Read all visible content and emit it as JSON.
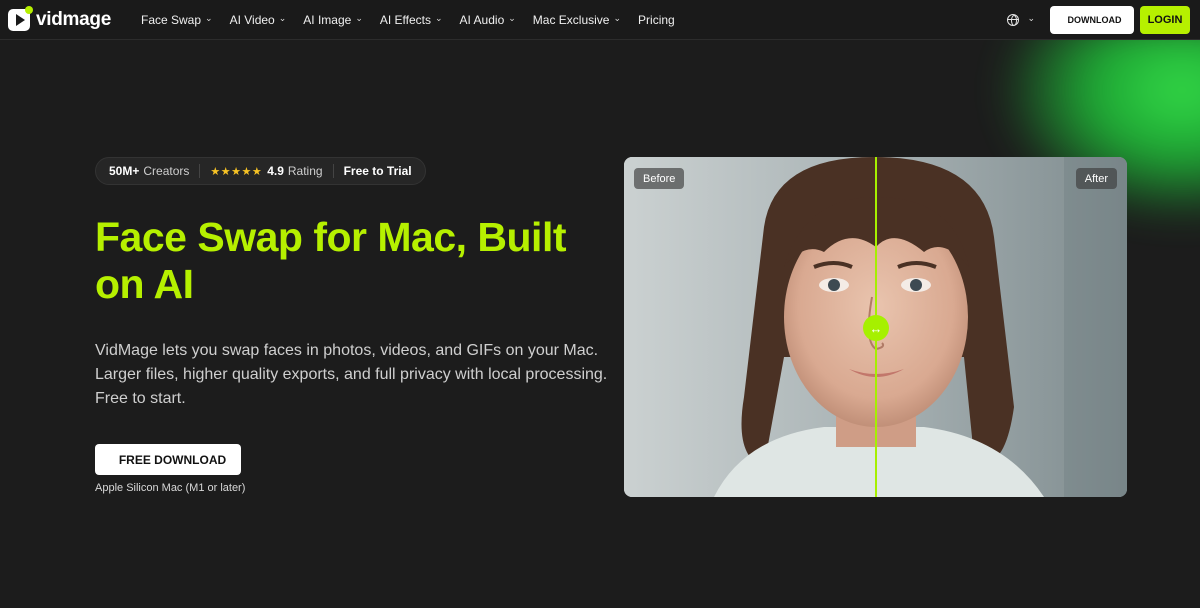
{
  "brand": {
    "name": "vidmage"
  },
  "nav": {
    "items": [
      {
        "label": "Face Swap",
        "dropdown": true
      },
      {
        "label": "AI Video",
        "dropdown": true
      },
      {
        "label": "AI Image",
        "dropdown": true
      },
      {
        "label": "AI Effects",
        "dropdown": true
      },
      {
        "label": "AI Audio",
        "dropdown": true
      },
      {
        "label": "Mac Exclusive",
        "dropdown": true
      },
      {
        "label": "Pricing",
        "dropdown": false
      }
    ],
    "language_icon": "globe-icon",
    "download_label": "DOWNLOAD",
    "login_label": "LOGIN"
  },
  "hero": {
    "stat_creators_value": "50M+",
    "stat_creators_label": "Creators",
    "stars": "★★★★★",
    "rating_value": "4.9",
    "rating_label": "Rating",
    "trial_label": "Free to Trial",
    "headline": "Face Swap for Mac, Built on AI",
    "description": "VidMage lets you swap faces in photos, videos, and GIFs on your Mac. Larger files, higher quality exports, and full privacy with local processing. Free to start.",
    "cta_label": "FREE DOWNLOAD",
    "cta_note": "Apple Silicon Mac (M1 or later)"
  },
  "compare": {
    "before_label": "Before",
    "after_label": "After",
    "handle_icon": "↔"
  },
  "colors": {
    "accent": "#b6f000",
    "background": "#1c1c1c",
    "glow": "#35e64a"
  }
}
